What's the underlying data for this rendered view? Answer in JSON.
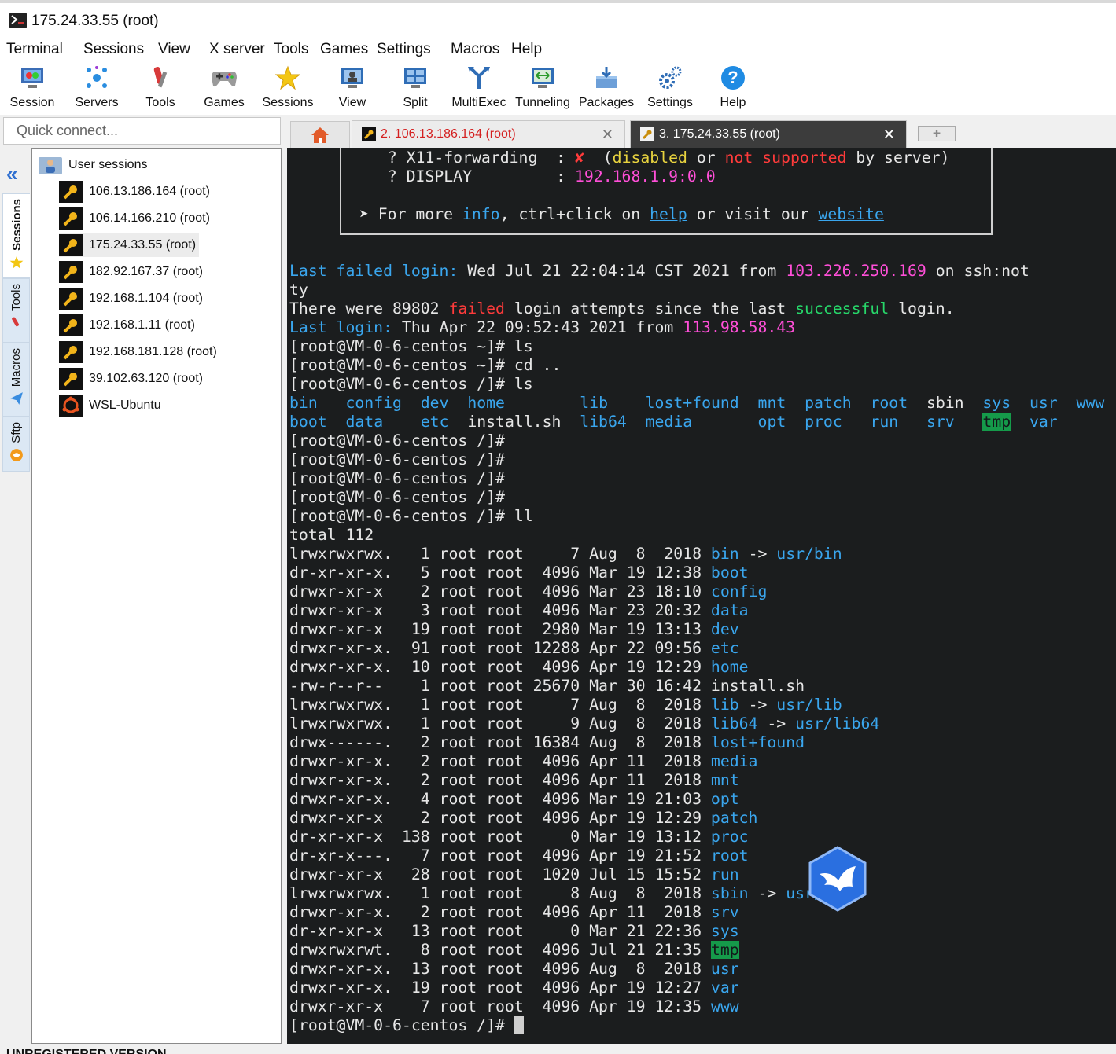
{
  "window": {
    "title": "175.24.33.55 (root)"
  },
  "menu": [
    "Terminal",
    "Sessions",
    "View",
    "X server",
    "Tools",
    "Games",
    "Settings",
    "Macros",
    "Help"
  ],
  "toolbar": [
    {
      "label": "Session",
      "icon": "session-icon"
    },
    {
      "label": "Servers",
      "icon": "servers-icon"
    },
    {
      "label": "Tools",
      "icon": "tools-icon"
    },
    {
      "label": "Games",
      "icon": "gamepad-icon"
    },
    {
      "label": "Sessions",
      "icon": "star-icon"
    },
    {
      "label": "View",
      "icon": "view-icon"
    },
    {
      "label": "Split",
      "icon": "split-icon"
    },
    {
      "label": "MultiExec",
      "icon": "multiexec-icon"
    },
    {
      "label": "Tunneling",
      "icon": "tunneling-icon"
    },
    {
      "label": "Packages",
      "icon": "packages-icon"
    },
    {
      "label": "Settings",
      "icon": "gear-icon"
    },
    {
      "label": "Help",
      "icon": "help-icon"
    }
  ],
  "quick_connect": {
    "placeholder": "Quick connect..."
  },
  "side_tabs": [
    "Sessions",
    "Tools",
    "Macros",
    "Sftp"
  ],
  "sessions": {
    "root_label": "User sessions",
    "items": [
      {
        "label": "106.13.186.164 (root)",
        "selected": false
      },
      {
        "label": "106.14.166.210 (root)",
        "selected": false
      },
      {
        "label": "175.24.33.55 (root)",
        "selected": true
      },
      {
        "label": "182.92.167.37 (root)",
        "selected": false
      },
      {
        "label": "192.168.1.104 (root)",
        "selected": false
      },
      {
        "label": "192.168.1.11 (root)",
        "selected": false
      },
      {
        "label": "192.168.181.128 (root)",
        "selected": false
      },
      {
        "label": "39.102.63.120 (root)",
        "selected": false
      },
      {
        "label": "WSL-Ubuntu",
        "selected": false
      }
    ]
  },
  "tabs": {
    "tab2": "2. 106.13.186.164 (root)",
    "tab3": "3. 175.24.33.55 (root)",
    "close_glyph": "✕"
  },
  "terminal": {
    "x11_label": "  ? X11-forwarding  : ",
    "x11_mark": "✘",
    "x11_open": "  (",
    "x11_disabled": "disabled",
    "x11_or": " or ",
    "x11_not_supported": "not supported",
    "x11_close": " by server)",
    "display_label": "  ? DISPLAY         : ",
    "display_value": "192.168.1.9:0.0",
    "more_prefix": " ➤ For more ",
    "more_info": "info",
    "more_mid": ", ctrl+click on ",
    "more_help": "help",
    "more_visit": " or visit our ",
    "more_website": "website",
    "lf_label": "Last failed login:",
    "lf_time": " Wed Jul 21 22:04:14 CST 2021 from ",
    "lf_ip": "103.226.250.169",
    "lf_tail": " on ssh:not",
    "lf_wrap": "ty",
    "tw_a": "There were 89802 ",
    "tw_failed": "failed",
    "tw_b": " login attempts since the last ",
    "tw_successful": "successful",
    "tw_c": " login.",
    "ll_label": "Last login:",
    "ll_time": " Thu Apr 22 09:52:43 2021 from ",
    "ll_ip": "113.98.58.43",
    "cmd_ls1": "[root@VM-0-6-centos ~]# ls",
    "cmd_cd": "[root@VM-0-6-centos ~]# cd ..",
    "cmd_ls2": "[root@VM-0-6-centos /]# ls",
    "ls_row1": [
      "bin",
      "config",
      "dev",
      "home",
      "lib",
      "lost+found",
      "mnt",
      "patch",
      "root",
      "sbin",
      "sys",
      "usr",
      "www"
    ],
    "ls_row2": [
      "boot",
      "data",
      "etc",
      "install.sh",
      "lib64",
      "media",
      "opt",
      "proc",
      "run",
      "srv",
      "tmp",
      "var"
    ],
    "empty_prompt": "[root@VM-0-6-centos /]#",
    "cmd_ll": "[root@VM-0-6-centos /]# ll",
    "total": "total 112",
    "ll_rows": [
      {
        "meta": "lrwxrwxrwx.   1 root root     7 Aug  8  2018 ",
        "name": "bin",
        "target": "usr/bin"
      },
      {
        "meta": "dr-xr-xr-x.   5 root root  4096 Mar 19 12:38 ",
        "name": "boot"
      },
      {
        "meta": "drwxr-xr-x    2 root root  4096 Mar 23 18:10 ",
        "name": "config"
      },
      {
        "meta": "drwxr-xr-x    3 root root  4096 Mar 23 20:32 ",
        "name": "data"
      },
      {
        "meta": "drwxr-xr-x   19 root root  2980 Mar 19 13:13 ",
        "name": "dev"
      },
      {
        "meta": "drwxr-xr-x.  91 root root 12288 Apr 22 09:56 ",
        "name": "etc"
      },
      {
        "meta": "drwxr-xr-x.  10 root root  4096 Apr 19 12:29 ",
        "name": "home"
      },
      {
        "meta": "-rw-r--r--    1 root root 25670 Mar 30 16:42 ",
        "name": "install.sh",
        "plain": true
      },
      {
        "meta": "lrwxrwxrwx.   1 root root     7 Aug  8  2018 ",
        "name": "lib",
        "target": "usr/lib"
      },
      {
        "meta": "lrwxrwxrwx.   1 root root     9 Aug  8  2018 ",
        "name": "lib64",
        "target": "usr/lib64"
      },
      {
        "meta": "drwx------.   2 root root 16384 Aug  8  2018 ",
        "name": "lost+found"
      },
      {
        "meta": "drwxr-xr-x.   2 root root  4096 Apr 11  2018 ",
        "name": "media"
      },
      {
        "meta": "drwxr-xr-x.   2 root root  4096 Apr 11  2018 ",
        "name": "mnt"
      },
      {
        "meta": "drwxr-xr-x.   4 root root  4096 Mar 19 21:03 ",
        "name": "opt"
      },
      {
        "meta": "drwxr-xr-x    2 root root  4096 Apr 19 12:29 ",
        "name": "patch"
      },
      {
        "meta": "dr-xr-xr-x  138 root root     0 Mar 19 13:12 ",
        "name": "proc"
      },
      {
        "meta": "dr-xr-x---.   7 root root  4096 Apr 19 21:52 ",
        "name": "root"
      },
      {
        "meta": "drwxr-xr-x   28 root root  1020 Jul 15 15:52 ",
        "name": "run"
      },
      {
        "meta": "lrwxrwxrwx.   1 root root     8 Aug  8  2018 ",
        "name": "sbin",
        "target": "usr/sbin"
      },
      {
        "meta": "drwxr-xr-x.   2 root root  4096 Apr 11  2018 ",
        "name": "srv"
      },
      {
        "meta": "dr-xr-xr-x   13 root root     0 Mar 21 22:36 ",
        "name": "sys"
      },
      {
        "meta": "drwxrwxrwt.   8 root root  4096 Jul 21 21:35 ",
        "name": "tmp",
        "highlight": true
      },
      {
        "meta": "drwxr-xr-x.  13 root root  4096 Aug  8  2018 ",
        "name": "usr"
      },
      {
        "meta": "drwxr-xr-x.  19 root root  4096 Apr 19 12:27 ",
        "name": "var"
      },
      {
        "meta": "drwxr-xr-x    7 root root  4096 Apr 19 12:35 ",
        "name": "www"
      }
    ],
    "final_prompt": "[root@VM-0-6-centos /]# "
  },
  "status": {
    "text": "UNREGISTERED VERSION"
  },
  "colors": {
    "terminal_bg": "#1b1d1e",
    "dir_blue": "#3aa6ee",
    "ip_magenta": "#ff4fd8",
    "warn_red": "#ff3b3b",
    "ok_green": "#27d76a",
    "note_yellow": "#e8d33f",
    "tab_active": "#3c3c3c"
  }
}
